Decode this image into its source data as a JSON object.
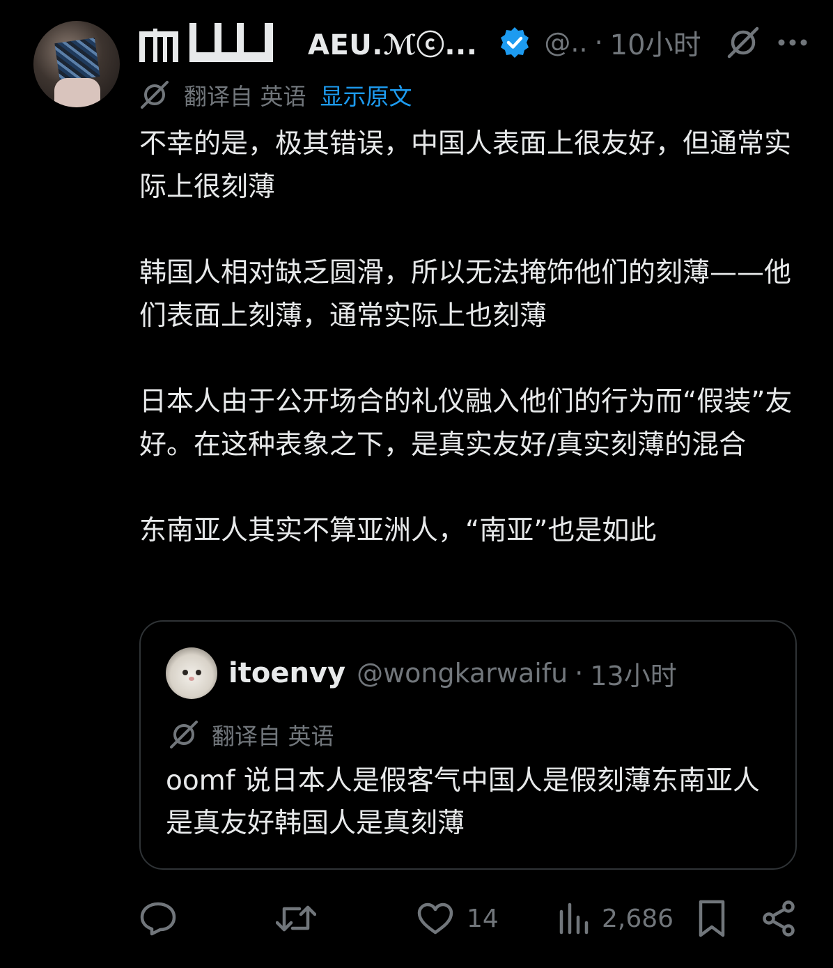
{
  "tweet": {
    "author": {
      "display_name": "AEU.ℳⓒ...",
      "handle": "@..",
      "verified": true
    },
    "time": "10小时",
    "translation": {
      "label": "翻译自 英语",
      "show_original": "显示原文"
    },
    "paragraphs": [
      "不幸的是，极其错误，中国人表面上很友好，但通常实际上很刻薄",
      "韩国人相对缺乏圆滑，所以无法掩饰他们的刻薄——他们表面上刻薄，通常实际上也刻薄",
      "日本人由于公开场合的礼仪融入他们的行为而“假装”友好。在这种表象之下，是真实友好/真实刻薄的混合",
      "东南亚人其实不算亚洲人，“南亚”也是如此"
    ]
  },
  "quote": {
    "display_name": "itoenvy",
    "handle": "@wongkarwaifu",
    "time": "13小时",
    "translation_label": "翻译自 英语",
    "text": "oomf 说日本人是假客气中国人是假刻薄东南亚人是真友好韩国人是真刻薄"
  },
  "actions": {
    "reply_count": "",
    "retweet_count": "",
    "like_count": "14",
    "views_count": "2,686"
  },
  "separator": "·",
  "colors": {
    "background": "#000000",
    "text_primary": "#e7e9ea",
    "text_secondary": "#71767b",
    "accent": "#1d9bf0",
    "border": "#2f3336"
  }
}
